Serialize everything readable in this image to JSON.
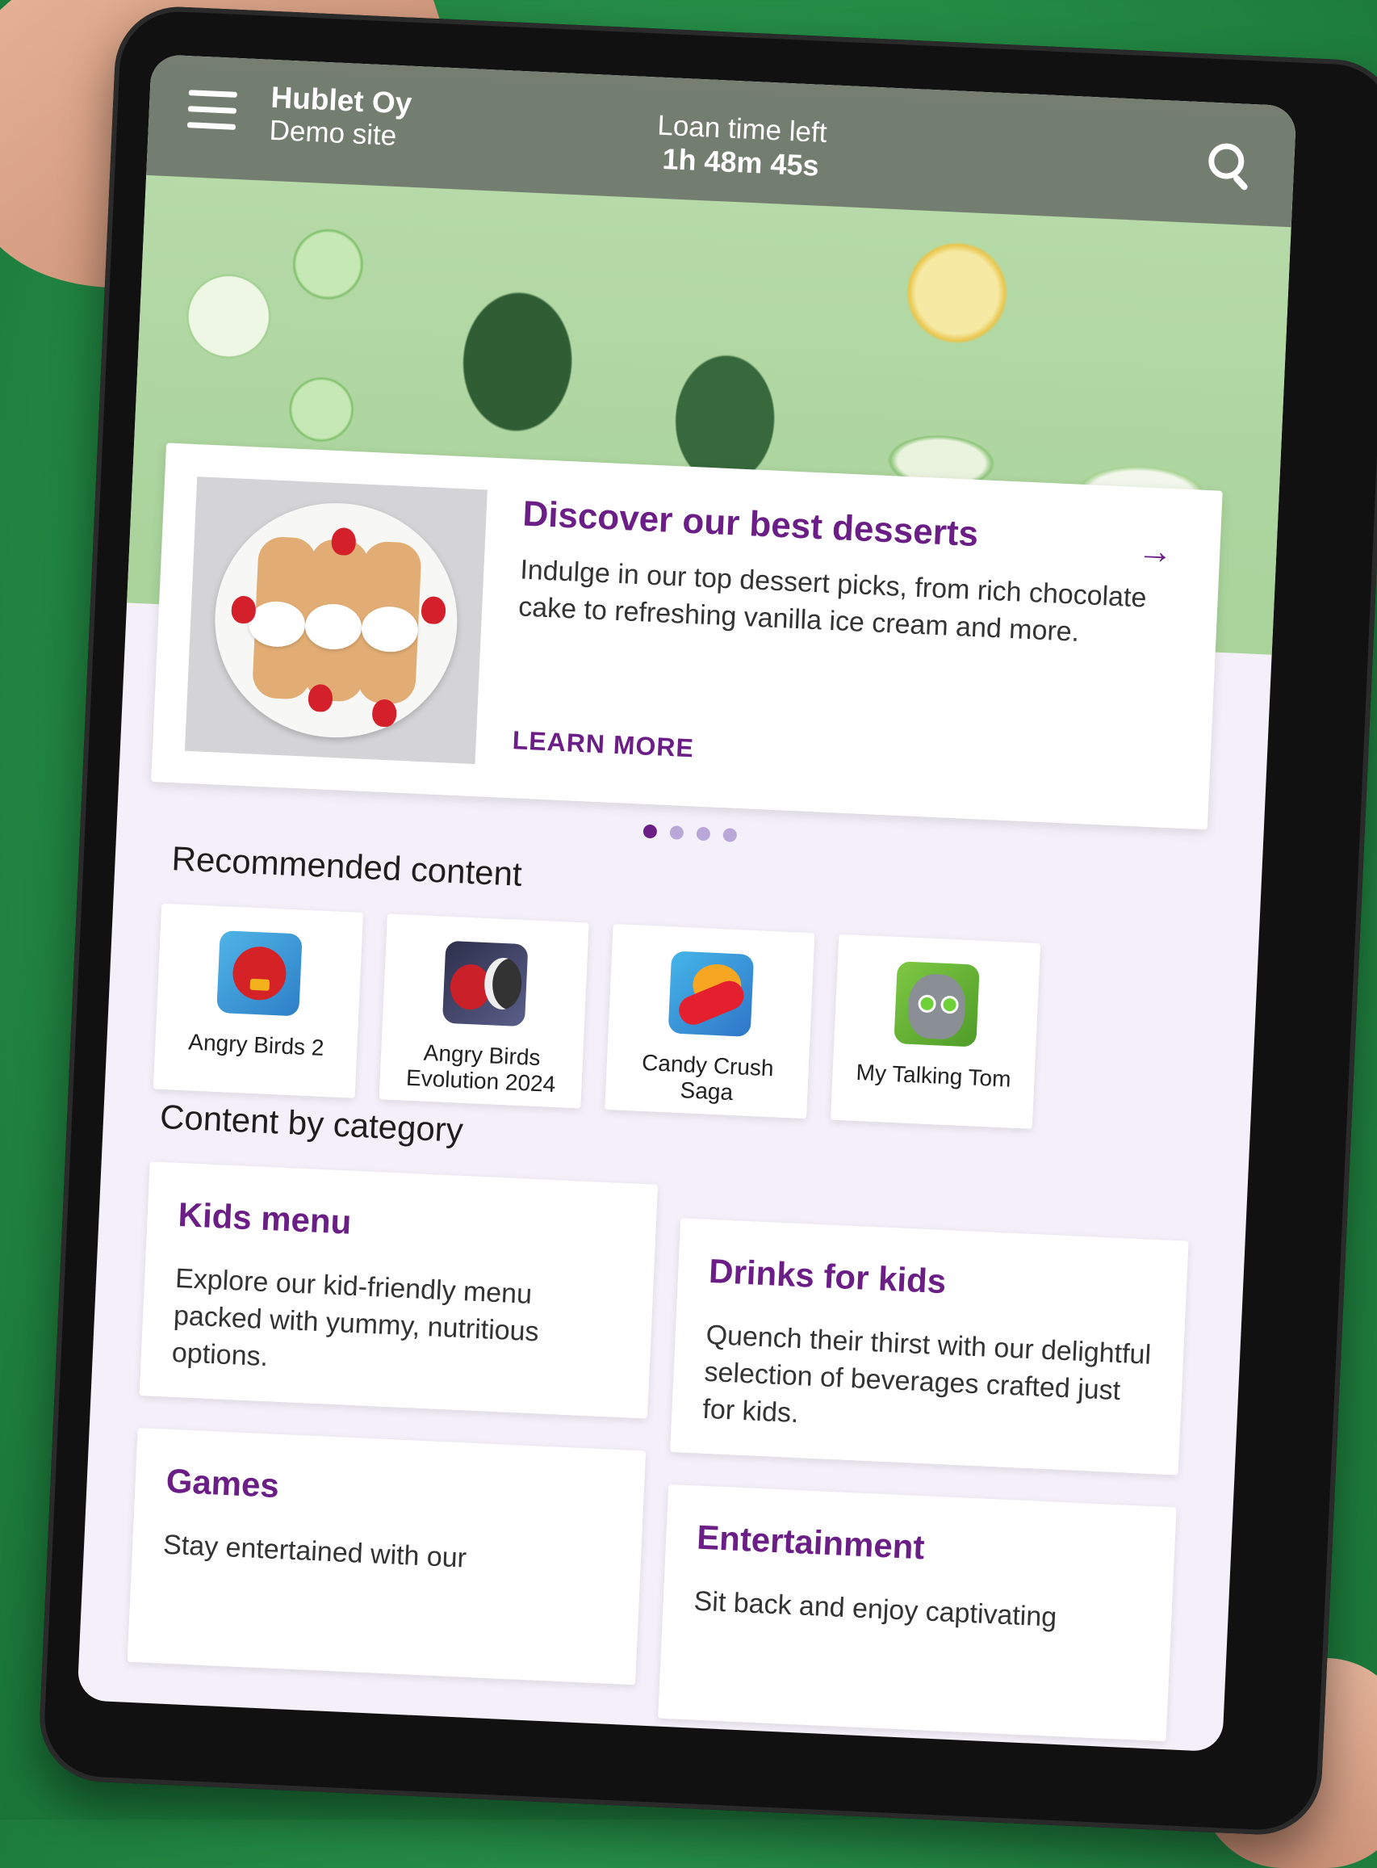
{
  "header": {
    "org_name": "Hublet Oy",
    "site_name": "Demo site",
    "loan_label": "Loan time left",
    "loan_time": "1h 48m 45s"
  },
  "carousel": {
    "title": "Discover our best desserts",
    "description": "Indulge in our top dessert picks, from rich chocolate cake to refreshing vanilla ice cream and more.",
    "link_label": "LEARN MORE",
    "arrow": "→",
    "total_slides": 4,
    "active_slide": 1
  },
  "recommended": {
    "title": "Recommended content",
    "apps": [
      {
        "name": "Angry Birds 2",
        "icon": "angry-birds-2-icon"
      },
      {
        "name": "Angry Birds Evolution 2024",
        "icon": "angry-birds-evolution-icon"
      },
      {
        "name": "Candy Crush Saga",
        "icon": "candy-crush-icon"
      },
      {
        "name": "My Talking Tom",
        "icon": "talking-tom-icon"
      }
    ]
  },
  "categories": {
    "title": "Content by category",
    "items": [
      {
        "title": "Kids menu",
        "description": "Explore our kid-friendly menu packed with yummy, nutritious options."
      },
      {
        "title": "Drinks for kids",
        "description": "Quench their thirst with our delightful selection of beverages crafted just for kids."
      },
      {
        "title": "Games",
        "description": "Stay entertained with our"
      },
      {
        "title": "Entertainment",
        "description": "Sit back and enjoy captivating"
      }
    ]
  },
  "colors": {
    "accent": "#6b1f86",
    "screen_bg": "#f4f0f9",
    "topbar": "#5a5a5a"
  }
}
